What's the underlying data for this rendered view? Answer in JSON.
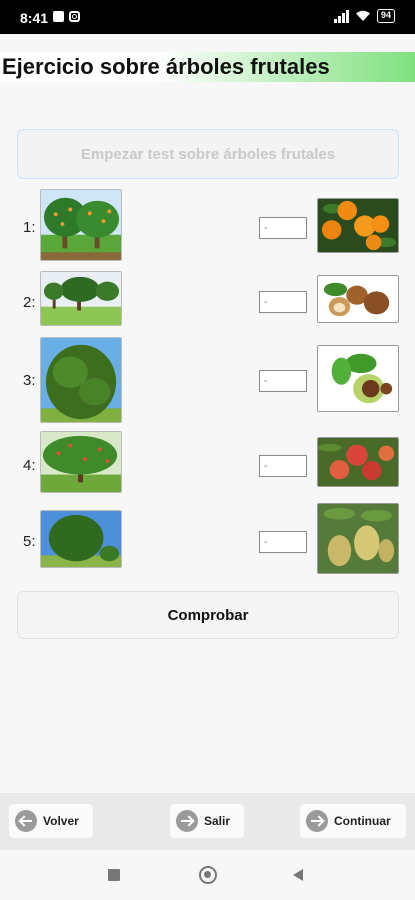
{
  "status_bar": {
    "time": "8:41",
    "battery": "94"
  },
  "header": {
    "title": "Ejercicio sobre árboles frutales"
  },
  "start_button": {
    "label": "Empezar test sobre árboles frutales"
  },
  "rows": [
    {
      "number": "1:",
      "answer": "-",
      "tree_icon": "orange-tree",
      "fruit_icon": "oranges"
    },
    {
      "number": "2:",
      "answer": "-",
      "tree_icon": "hazel-tree",
      "fruit_icon": "hazelnuts"
    },
    {
      "number": "3:",
      "answer": "-",
      "tree_icon": "chestnut-tree",
      "fruit_icon": "chestnuts"
    },
    {
      "number": "4:",
      "answer": "-",
      "tree_icon": "peach-tree",
      "fruit_icon": "peaches"
    },
    {
      "number": "5:",
      "answer": "-",
      "tree_icon": "pear-tree",
      "fruit_icon": "pears"
    }
  ],
  "check_button": {
    "label": "Comprobar"
  },
  "nav": {
    "back": "Volver",
    "exit": "Salir",
    "continue": "Continuar"
  }
}
